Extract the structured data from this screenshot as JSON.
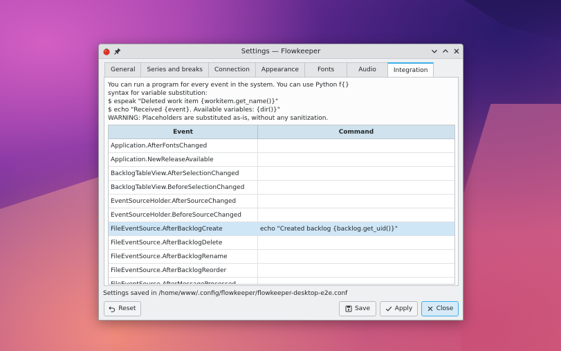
{
  "window": {
    "title": "Settings — Flowkeeper"
  },
  "tabs": [
    {
      "label": "General"
    },
    {
      "label": "Series and breaks"
    },
    {
      "label": "Connection"
    },
    {
      "label": "Appearance"
    },
    {
      "label": "Fonts"
    },
    {
      "label": "Audio"
    },
    {
      "label": "Integration"
    }
  ],
  "active_tab": "Integration",
  "intro": {
    "line1": "You can run a program for every event in the system. You can use Python f{}",
    "line2": "syntax for variable substitution:",
    "line3": "$ espeak \"Deleted work item {workitem.get_name()}\"",
    "line4": "$ echo \"Received {event}. Available variables: {dir()}\"",
    "line5": "WARNING: Placeholders are substituted as-is, without any sanitization."
  },
  "table": {
    "headers": {
      "event": "Event",
      "command": "Command"
    },
    "rows": [
      {
        "event": "Application.AfterFontsChanged",
        "command": ""
      },
      {
        "event": "Application.NewReleaseAvailable",
        "command": ""
      },
      {
        "event": "BacklogTableView.AfterSelectionChanged",
        "command": ""
      },
      {
        "event": "BacklogTableView.BeforeSelectionChanged",
        "command": ""
      },
      {
        "event": "EventSourceHolder.AfterSourceChanged",
        "command": ""
      },
      {
        "event": "EventSourceHolder.BeforeSourceChanged",
        "command": ""
      },
      {
        "event": "FileEventSource.AfterBacklogCreate",
        "command": "echo \"Created backlog {backlog.get_uid()}\""
      },
      {
        "event": "FileEventSource.AfterBacklogDelete",
        "command": ""
      },
      {
        "event": "FileEventSource.AfterBacklogRename",
        "command": ""
      },
      {
        "event": "FileEventSource.AfterBacklogReorder",
        "command": ""
      },
      {
        "event": "FileEventSource.AfterMessageProcessed",
        "command": ""
      }
    ],
    "selected_row": "FileEventSource.AfterBacklogCreate"
  },
  "status": {
    "text": "Settings saved in /home/www/.config/flowkeeper/flowkeeper-desktop-e2e.conf"
  },
  "buttons": {
    "reset": "Reset",
    "save": "Save",
    "apply": "Apply",
    "close": "Close"
  },
  "colors": {
    "accent": "#3daee9",
    "selection": "#cfe6f6",
    "header_bg": "#cfe2ee"
  }
}
